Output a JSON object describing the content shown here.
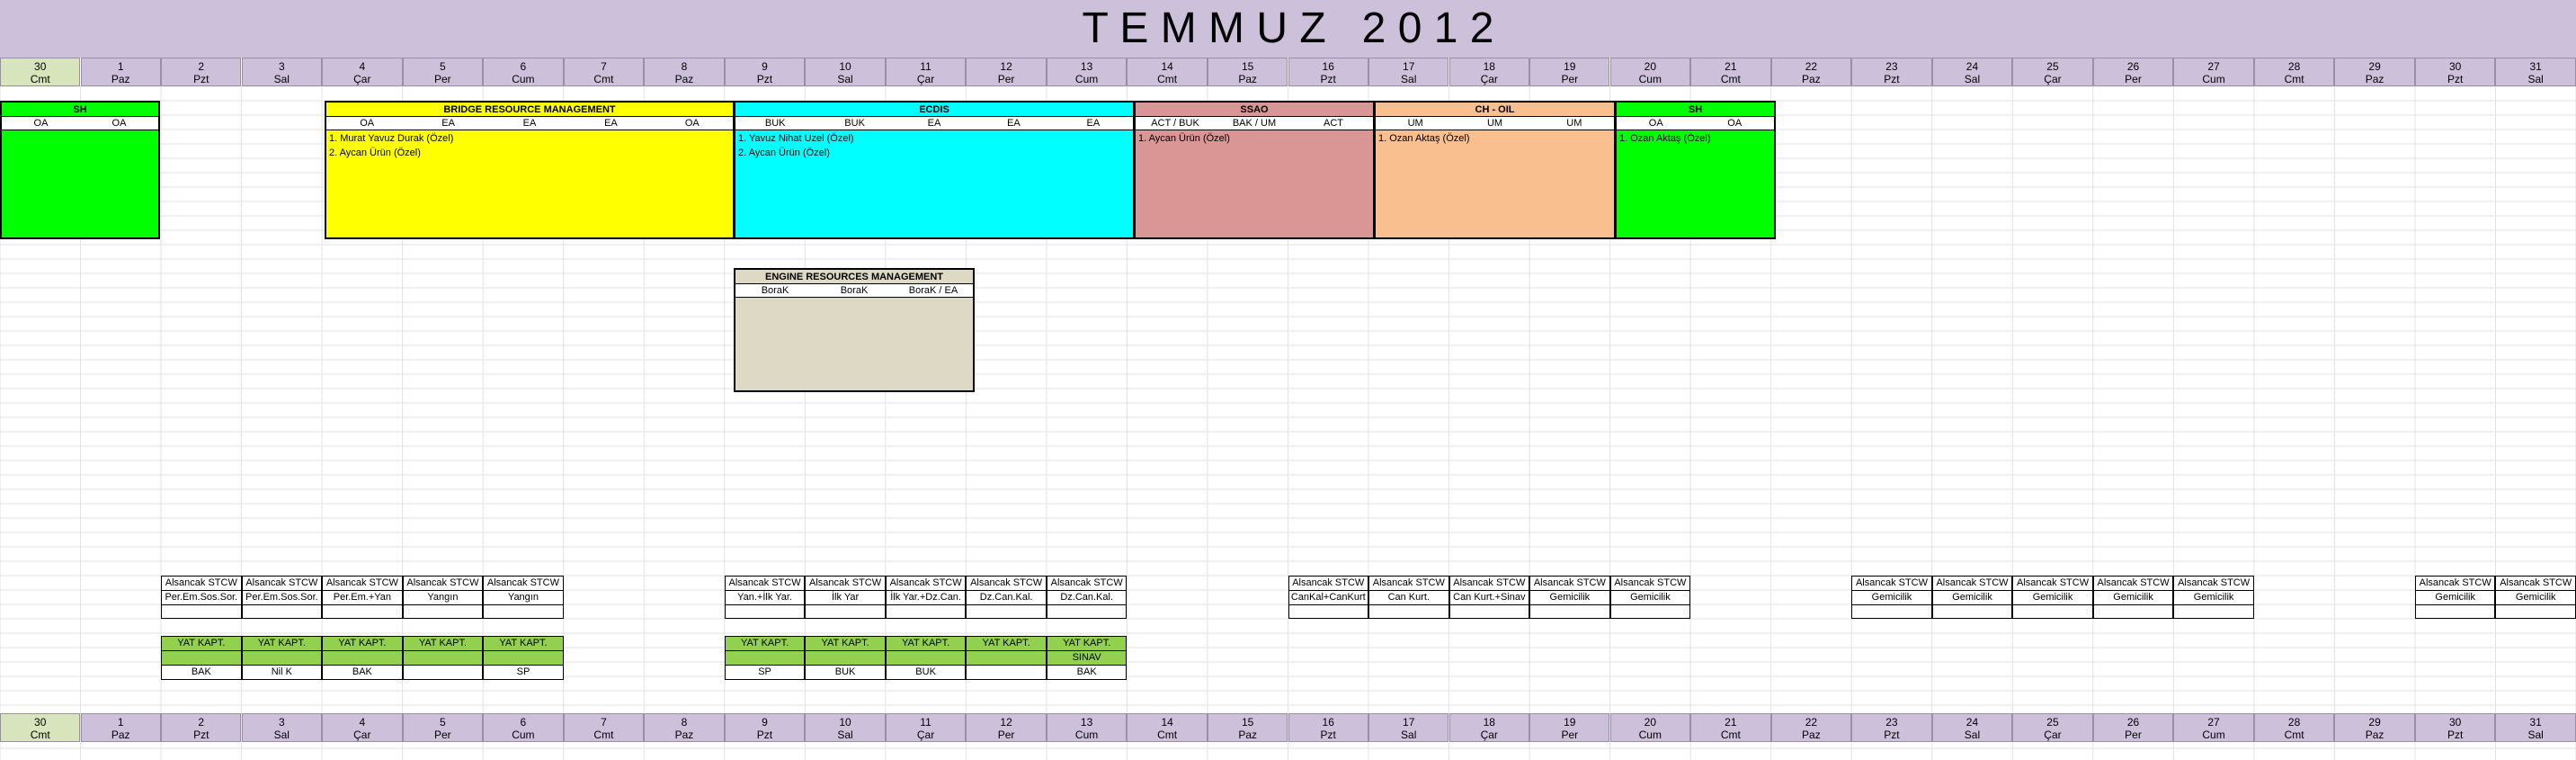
{
  "title": "T E M M U Z   2 0 1 2",
  "colors": {
    "header": "#ccc0da",
    "first_day": "#d8e4bc",
    "sh": "#00ff00",
    "brm": "#ffff00",
    "ecdis": "#00ffff",
    "ssao": "#da9694",
    "ch_oil": "#fabf8f",
    "erm": "#ddd9c4",
    "yat": "#92d050"
  },
  "days": [
    {
      "num": "30",
      "name": "Cmt"
    },
    {
      "num": "1",
      "name": "Paz"
    },
    {
      "num": "2",
      "name": "Pzt"
    },
    {
      "num": "3",
      "name": "Sal"
    },
    {
      "num": "4",
      "name": "Çar"
    },
    {
      "num": "5",
      "name": "Per"
    },
    {
      "num": "6",
      "name": "Cum"
    },
    {
      "num": "7",
      "name": "Cmt"
    },
    {
      "num": "8",
      "name": "Paz"
    },
    {
      "num": "9",
      "name": "Pzt"
    },
    {
      "num": "10",
      "name": "Sal"
    },
    {
      "num": "11",
      "name": "Çar"
    },
    {
      "num": "12",
      "name": "Per"
    },
    {
      "num": "13",
      "name": "Cum"
    },
    {
      "num": "14",
      "name": "Cmt"
    },
    {
      "num": "15",
      "name": "Paz"
    },
    {
      "num": "16",
      "name": "Pzt"
    },
    {
      "num": "17",
      "name": "Sal"
    },
    {
      "num": "18",
      "name": "Çar"
    },
    {
      "num": "19",
      "name": "Per"
    },
    {
      "num": "20",
      "name": "Cum"
    },
    {
      "num": "21",
      "name": "Cmt"
    },
    {
      "num": "22",
      "name": "Paz"
    },
    {
      "num": "23",
      "name": "Pzt"
    },
    {
      "num": "24",
      "name": "Sal"
    },
    {
      "num": "25",
      "name": "Çar"
    },
    {
      "num": "26",
      "name": "Per"
    },
    {
      "num": "27",
      "name": "Cum"
    },
    {
      "num": "28",
      "name": "Cmt"
    },
    {
      "num": "29",
      "name": "Paz"
    },
    {
      "num": "30",
      "name": "Pzt"
    },
    {
      "num": "31",
      "name": "Sal"
    }
  ],
  "courses": [
    {
      "id": "sh1",
      "title": "SH",
      "color": "#00ff00",
      "subs": [
        "OA",
        "OA"
      ],
      "lines": []
    },
    {
      "id": "brm",
      "title": "BRIDGE RESOURCE MANAGEMENT",
      "color": "#ffff00",
      "subs": [
        "OA",
        "EA",
        "EA",
        "EA",
        "OA"
      ],
      "lines": [
        "1. Murat Yavuz Durak (Özel)",
        "2. Aycan Ürün (Özel)"
      ]
    },
    {
      "id": "ecdis",
      "title": "ECDIS",
      "color": "#00ffff",
      "subs": [
        "BUK",
        "BUK",
        "EA",
        "EA",
        "EA"
      ],
      "lines": [
        "1. Yavuz Nihat Uzel (Özel)",
        "2. Aycan Ürün (Özel)"
      ]
    },
    {
      "id": "ssao",
      "title": "SSAO",
      "color": "#da9694",
      "subs": [
        "ACT / BUK",
        "BAK / UM",
        "ACT"
      ],
      "lines": [
        "1. Aycan Ürün (Özel)"
      ]
    },
    {
      "id": "choil",
      "title": "CH - OIL",
      "color": "#fabf8f",
      "subs": [
        "UM",
        "UM",
        "UM"
      ],
      "lines": [
        "1. Ozan Aktaş (Özel)"
      ]
    },
    {
      "id": "sh2",
      "title": "SH",
      "color": "#00ff00",
      "subs": [
        "OA",
        "OA"
      ],
      "lines": [
        "1. Ozan Aktaş (Özel)"
      ]
    },
    {
      "id": "erm",
      "title": "ENGINE RESOURCES MANAGEMENT",
      "color": "#ddd9c4",
      "subs": [
        "BoraK",
        "BoraK",
        "BoraK / EA"
      ],
      "lines": []
    }
  ],
  "stcw_label": "Alsancak STCW",
  "stcw": [
    {
      "col": 2,
      "topic": "Per.Em.Sos.Sor."
    },
    {
      "col": 3,
      "topic": "Per.Em.Sos.Sor."
    },
    {
      "col": 4,
      "topic": "Per.Em.+Yan"
    },
    {
      "col": 5,
      "topic": "Yangın"
    },
    {
      "col": 6,
      "topic": "Yangın"
    },
    {
      "col": 9,
      "topic": "Yan.+İlk Yar."
    },
    {
      "col": 10,
      "topic": "İlk Yar"
    },
    {
      "col": 11,
      "topic": "İlk Yar.+Dz.Can."
    },
    {
      "col": 12,
      "topic": "Dz.Can.Kal."
    },
    {
      "col": 13,
      "topic": "Dz.Can.Kal."
    },
    {
      "col": 16,
      "topic": "CanKal+CanKurt"
    },
    {
      "col": 17,
      "topic": "Can Kurt."
    },
    {
      "col": 18,
      "topic": "Can Kurt.+Sinav"
    },
    {
      "col": 19,
      "topic": "Gemicilik"
    },
    {
      "col": 20,
      "topic": "Gemicilik"
    },
    {
      "col": 23,
      "topic": "Gemicilik"
    },
    {
      "col": 24,
      "topic": "Gemicilik"
    },
    {
      "col": 25,
      "topic": "Gemicilik"
    },
    {
      "col": 26,
      "topic": "Gemicilik"
    },
    {
      "col": 27,
      "topic": "Gemicilik"
    },
    {
      "col": 30,
      "topic": "Gemicilik"
    },
    {
      "col": 31,
      "topic": "Gemicilik"
    }
  ],
  "yat_label": "YAT KAPT.",
  "yat": [
    {
      "col": 2,
      "extra": "",
      "instructor": "BAK"
    },
    {
      "col": 3,
      "extra": "",
      "instructor": "Nil K"
    },
    {
      "col": 4,
      "extra": "",
      "instructor": "BAK"
    },
    {
      "col": 5,
      "extra": "",
      "instructor": ""
    },
    {
      "col": 6,
      "extra": "",
      "instructor": "SP"
    },
    {
      "col": 9,
      "extra": "",
      "instructor": "SP"
    },
    {
      "col": 10,
      "extra": "",
      "instructor": "BUK"
    },
    {
      "col": 11,
      "extra": "",
      "instructor": "BUK"
    },
    {
      "col": 12,
      "extra": "",
      "instructor": ""
    },
    {
      "col": 13,
      "extra": "SINAV",
      "instructor": "BAK"
    }
  ]
}
